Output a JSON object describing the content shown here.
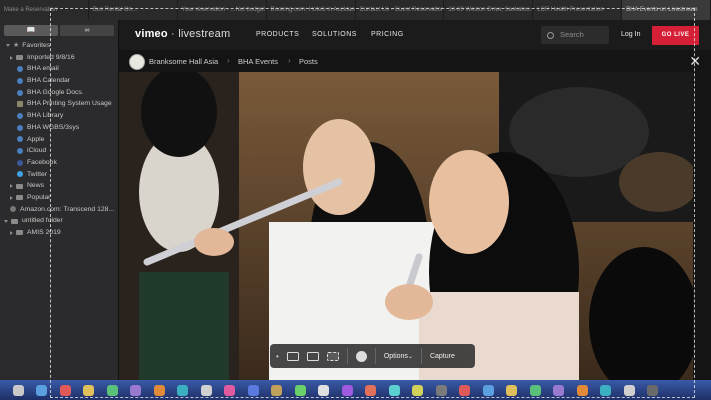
{
  "tabs": [
    "Make a Reservation",
    "Bus Rental On...",
    "Your reservation - ...Not budget Au...",
    "Booking.com: Hotels in Auckland...",
    "Contact Us - Guest Reservations",
    "10-60 Weston Drive, Saskatoo...",
    "LCR Health Presentation",
    "BHA Events on Livestream"
  ],
  "sidebar": {
    "view_buttons": [
      "book-icon",
      "glasses-icon"
    ],
    "items": [
      {
        "label": "Favorites",
        "type": "section"
      },
      {
        "label": "Imported 9/8/16",
        "type": "folder"
      },
      {
        "label": "BHA email",
        "type": "bookmark"
      },
      {
        "label": "BHA Calendar",
        "type": "bookmark"
      },
      {
        "label": "BHA Google Docs.",
        "type": "bookmark"
      },
      {
        "label": "BHA Printing System Usage",
        "type": "bookmark"
      },
      {
        "label": "BHA Library",
        "type": "bookmark"
      },
      {
        "label": "BHA WGBS/3sys",
        "type": "bookmark"
      },
      {
        "label": "Apple",
        "type": "bookmark"
      },
      {
        "label": "iCloud",
        "type": "bookmark"
      },
      {
        "label": "Facebook",
        "type": "bookmark"
      },
      {
        "label": "Twitter",
        "type": "bookmark"
      },
      {
        "label": "News",
        "type": "folder"
      },
      {
        "label": "Popular",
        "type": "folder"
      },
      {
        "label": "Amazon.com: Transcend 128...",
        "type": "bookmark"
      },
      {
        "label": "untitled folder",
        "type": "section"
      },
      {
        "label": "AMIS 2019",
        "type": "folder"
      }
    ]
  },
  "nav": {
    "logo_bold": "vimeo",
    "logo_rest": "livestream",
    "links": [
      "PRODUCTS",
      "SOLUTIONS",
      "PRICING"
    ],
    "search_placeholder": "Search",
    "login": "Log In",
    "golive": "GO LIVE"
  },
  "breadcrumb": {
    "account": "Branksome Hall Asia",
    "events": "BHA Events",
    "posts": "Posts"
  },
  "capture_bar": {
    "options": "Options",
    "capture": "Capture"
  },
  "colors": {
    "accent": "#d41f36",
    "dock_top": "#3a5aa8",
    "dock_bottom": "#1e2f66"
  }
}
